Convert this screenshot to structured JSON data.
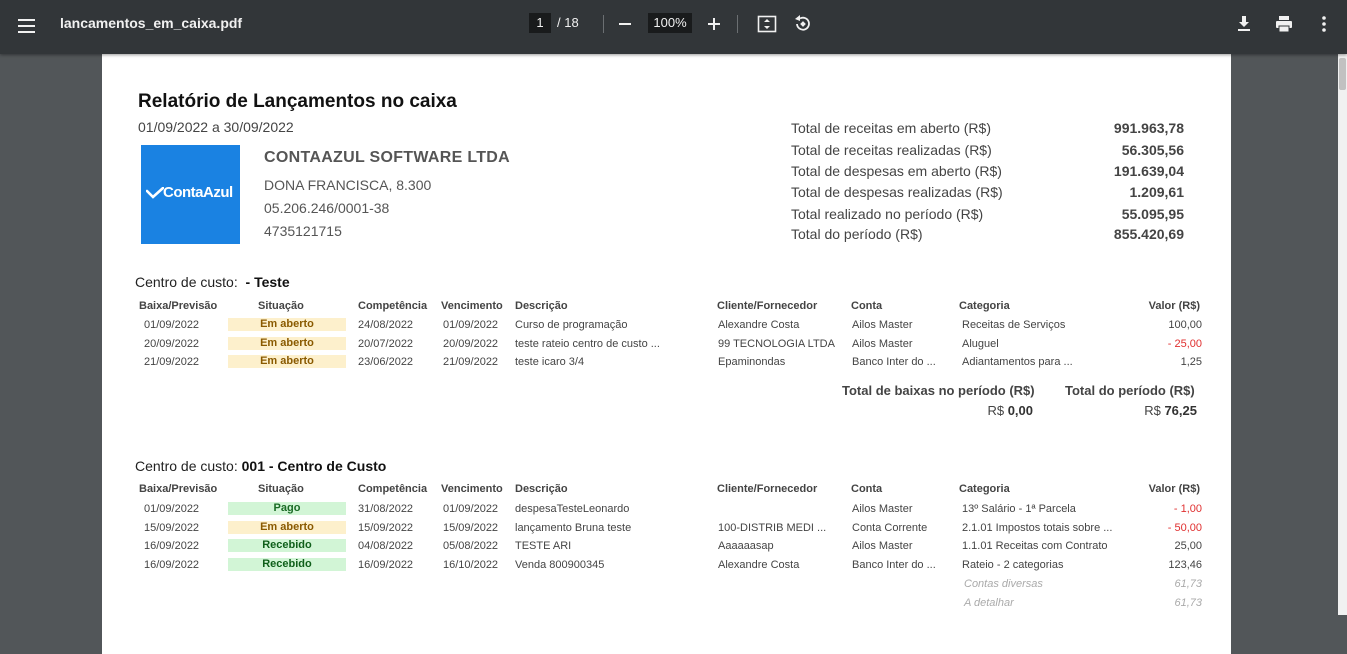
{
  "toolbar": {
    "title": "lancamentos_em_caixa.pdf",
    "page_current": "1",
    "page_total": "/ 18",
    "zoom": "100%"
  },
  "report": {
    "title": "Relatório de Lançamentos no caixa",
    "period": "01/09/2022 a 30/09/2022",
    "logo_text": "ContaAzul",
    "company": {
      "name": "CONTAAZUL SOFTWARE LTDA",
      "address": "DONA FRANCISCA, 8.300",
      "cnpj": "05.206.246/0001-38",
      "phone": "4735121715"
    },
    "totals": [
      {
        "label": "Total de receitas em aberto (R$)",
        "value": "991.963,78"
      },
      {
        "label": "Total de receitas realizadas (R$)",
        "value": "56.305,56"
      },
      {
        "label": "Total de despesas em aberto (R$)",
        "value": "191.639,04"
      },
      {
        "label": "Total de despesas realizadas (R$)",
        "value": "1.209,61"
      },
      {
        "label": "Total realizado no período (R$)",
        "value": "55.095,95"
      },
      {
        "label": "Total do período (R$)",
        "value": "855.420,69"
      }
    ]
  },
  "columns": {
    "baixa": "Baixa/Previsão",
    "situacao": "Situação",
    "competencia": "Competência",
    "vencimento": "Vencimento",
    "descricao": "Descrição",
    "cliente": "Cliente/Fornecedor",
    "conta": "Conta",
    "categoria": "Categoria",
    "valor": "Valor (R$)"
  },
  "sections": [
    {
      "label": "Centro de custo:",
      "name": "- Teste",
      "rows": [
        {
          "baixa": "01/09/2022",
          "situacao": "Em aberto",
          "competencia": "24/08/2022",
          "vencimento": "01/09/2022",
          "descricao": "Curso de programação",
          "cliente": "Alexandre Costa",
          "conta": "Ailos Master",
          "categoria": "Receitas de Serviços",
          "valor": "100,00"
        },
        {
          "baixa": "20/09/2022",
          "situacao": "Em aberto",
          "competencia": "20/07/2022",
          "vencimento": "20/09/2022",
          "descricao": "teste rateio centro de custo ...",
          "cliente": "99 TECNOLOGIA LTDA",
          "conta": "Ailos Master",
          "categoria": "Aluguel",
          "valor": "- 25,00"
        },
        {
          "baixa": "21/09/2022",
          "situacao": "Em aberto",
          "competencia": "23/06/2022",
          "vencimento": "21/09/2022",
          "descricao": "teste icaro 3/4",
          "cliente": "Epaminondas",
          "conta": "Banco Inter do ...",
          "categoria": "Adiantamentos para ...",
          "valor": "1,25"
        }
      ],
      "summary": {
        "baixas_label": "Total de baixas no período (R$)",
        "baixas_currency": "R$",
        "baixas_value": "0,00",
        "periodo_label": "Total do período (R$)",
        "periodo_currency": "R$",
        "periodo_value": "76,25"
      }
    },
    {
      "label": "Centro de custo:",
      "name": "001 - Centro de Custo",
      "rows": [
        {
          "baixa": "01/09/2022",
          "situacao": "Pago",
          "competencia": "31/08/2022",
          "vencimento": "01/09/2022",
          "descricao": "despesaTesteLeonardo",
          "cliente": "",
          "conta": "Ailos Master",
          "categoria": "13º Salário - 1ª Parcela",
          "valor": "- 1,00"
        },
        {
          "baixa": "15/09/2022",
          "situacao": "Em aberto",
          "competencia": "15/09/2022",
          "vencimento": "15/09/2022",
          "descricao": "lançamento Bruna teste",
          "cliente": "100-DISTRIB MEDI ...",
          "conta": "Conta Corrente",
          "categoria": "2.1.01 Impostos totais sobre ...",
          "valor": "- 50,00"
        },
        {
          "baixa": "16/09/2022",
          "situacao": "Recebido",
          "competencia": "04/08/2022",
          "vencimento": "05/08/2022",
          "descricao": "TESTE ARI",
          "cliente": "Aaaaaasap",
          "conta": "Ailos Master",
          "categoria": "1.1.01 Receitas com Contrato",
          "valor": "25,00"
        },
        {
          "baixa": "16/09/2022",
          "situacao": "Recebido",
          "competencia": "16/09/2022",
          "vencimento": "16/10/2022",
          "descricao": "Venda 800900345",
          "cliente": "Alexandre Costa",
          "conta": "Banco Inter do ...",
          "categoria": "Rateio - 2 categorias",
          "valor": "123,46"
        }
      ],
      "subrows": [
        {
          "categoria": "Contas diversas",
          "valor": "61,73"
        },
        {
          "categoria": "A detalhar",
          "valor": "61,73"
        }
      ]
    }
  ],
  "colors": {
    "toolbar_bg": "#323639",
    "viewer_bg": "#525659",
    "logo_bg": "#1a82e2",
    "status_open_bg": "#fdf0cc",
    "status_paid_bg": "#d2f5d6",
    "negative": "#e03030"
  },
  "icons": [
    "menu-icon",
    "zoom-out-icon",
    "zoom-in-icon",
    "fit-page-icon",
    "rotate-icon",
    "download-icon",
    "print-icon",
    "more-vert-icon"
  ]
}
